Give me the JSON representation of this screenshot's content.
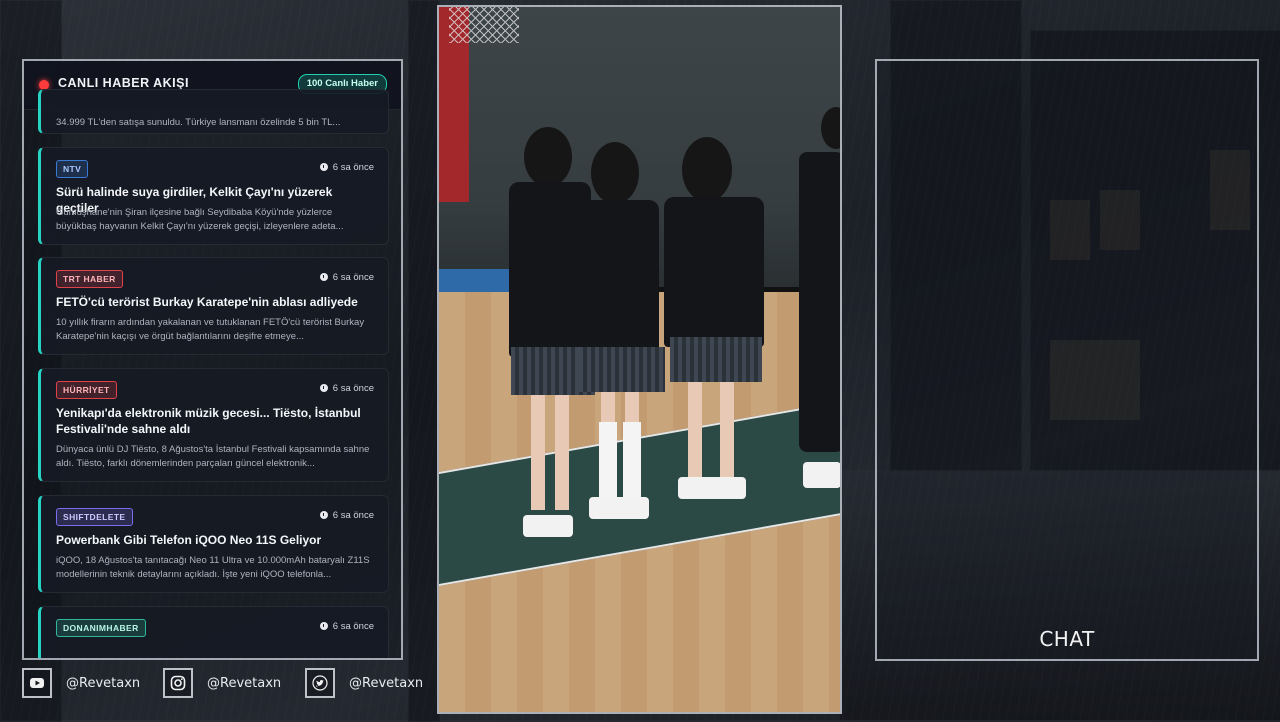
{
  "news_panel": {
    "title": "CANLI HABER AKIŞI",
    "live_count": "100 Canlı Haber",
    "partial_top_summary": "34.999 TL'den satışa sunuldu. Türkiye lansmanı özelinde 5 bin TL...",
    "items": [
      {
        "source": "NTV",
        "time": "6 sa önce",
        "headline": "Sürü halinde suya girdiler, Kelkit Çayı'nı yüzerek geçtiler",
        "summary": "Gümüşhane'nin Şiran ilçesine bağlı Seydibaba Köyü'nde yüzlerce büyükbaş hayvanın Kelkit Çayı'nı yüzerek geçişi, izleyenlere adeta..."
      },
      {
        "source": "TRT HABER",
        "time": "6 sa önce",
        "headline": "FETÖ'cü terörist Burkay Karatepe'nin ablası adliyede",
        "summary": "10 yıllık firarın ardından yakalanan ve tutuklanan FETÖ'cü terörist Burkay Karatepe'nin kaçışı ve örgüt bağlantılarını deşifre etmeye..."
      },
      {
        "source": "HÜRRİYET",
        "time": "6 sa önce",
        "headline": "Yenikapı'da elektronik müzik gecesi... Tiësto, İstanbul Festivali'nde sahne aldı",
        "summary": "Dünyaca ünlü DJ Tiësto, 8 Ağustos'ta İstanbul Festivali kapsamında sahne aldı. Tiësto, farklı dönemlerinden parçaları güncel elektronik..."
      },
      {
        "source": "SHIFTDELETE",
        "time": "6 sa önce",
        "headline": "Powerbank Gibi Telefon iQOO Neo 11S Geliyor",
        "summary": "iQOO, 18 Ağustos'ta tanıtacağı Neo 11 Ultra ve 10.000mAh bataryalı Z11S modellerinin teknik detaylarını açıkladı. İşte yeni iQOO telefonla..."
      },
      {
        "source": "DONANIMHABER",
        "time": "6 sa önce",
        "headline": "",
        "summary": ""
      }
    ],
    "badge_colors": {
      "NTV": "#3a7bd5",
      "TRT HABER": "#e0424a",
      "HÜRRİYET": "#e0424a",
      "SHIFTDELETE": "#7b6cf0",
      "DONANIMHABER": "#2fb89b"
    }
  },
  "chat": {
    "label": "CHAT"
  },
  "socials": [
    {
      "platform": "youtube-icon",
      "handle": "@Revetaxn"
    },
    {
      "platform": "instagram-icon",
      "handle": "@Revetaxn"
    },
    {
      "platform": "twitter-icon",
      "handle": "@Revetaxn"
    }
  ],
  "colors": {
    "accent": "#27d3c3",
    "live": "#ff3b3b"
  }
}
